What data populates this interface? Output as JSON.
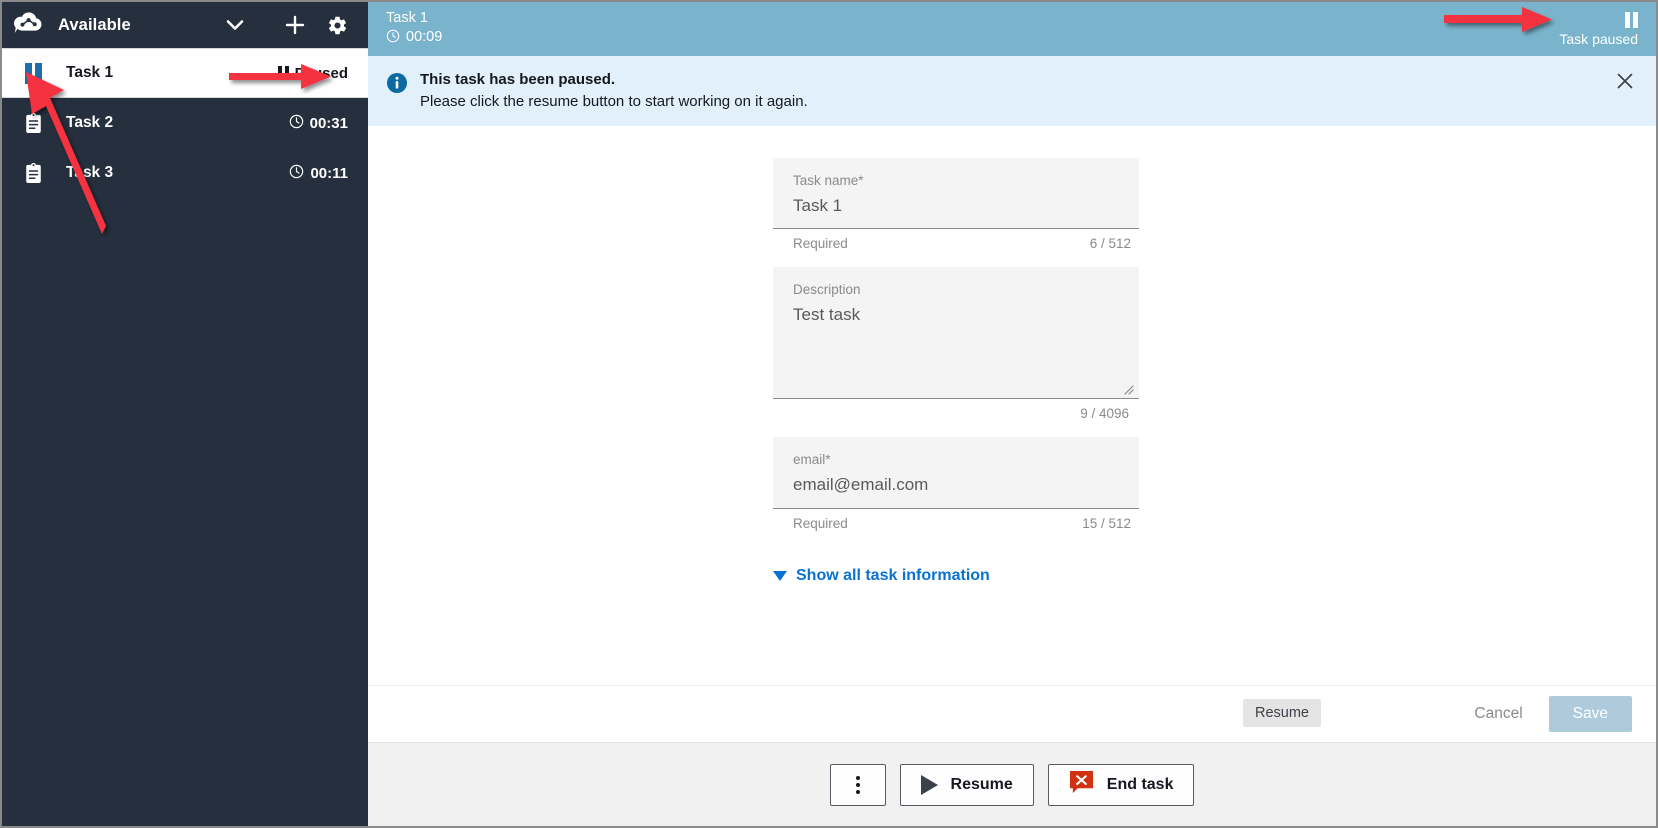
{
  "sidebar": {
    "logo_icon": "cloud-graph-logo-icon",
    "status": "Available",
    "chevron_icon": "chevron-down-icon",
    "plus_icon": "plus-icon",
    "gear_icon": "gear-icon",
    "tasks": [
      {
        "name": "Task 1",
        "icon": "pause-icon",
        "meta": "Paused",
        "meta_icon": "pause-icon",
        "active": true
      },
      {
        "name": "Task 2",
        "icon": "clipboard-icon",
        "meta": "00:31",
        "meta_icon": "clock-icon",
        "active": false
      },
      {
        "name": "Task 3",
        "icon": "clipboard-icon",
        "meta": "00:11",
        "meta_icon": "clock-icon",
        "active": false
      }
    ]
  },
  "task_header": {
    "title": "Task 1",
    "timer": "00:09",
    "timer_icon": "clock-icon",
    "status": "Task paused",
    "status_icon": "pause-icon",
    "bg_color": "#7ab4cc"
  },
  "banner": {
    "icon": "info-icon",
    "title": "This task has been paused.",
    "subtitle": "Please click the resume button to start working on it again.",
    "close_icon": "close-icon",
    "bg_color": "#e1f0fa"
  },
  "form": {
    "fields": [
      {
        "label": "Task name*",
        "value": "Task 1",
        "help_left": "Required",
        "help_right": "6 / 512",
        "type": "text"
      },
      {
        "label": "Description",
        "value": "Test task",
        "help_left": "",
        "help_right": "9 / 4096",
        "type": "textarea"
      },
      {
        "label": "email*",
        "value": "email@email.com",
        "help_left": "Required",
        "help_right": "15 / 512",
        "type": "text"
      }
    ],
    "show_all_label": "Show all task information",
    "show_all_icon": "triangle-down-icon",
    "link_color": "#0972d3"
  },
  "save_bar": {
    "cancel_label": "Cancel",
    "save_label": "Save",
    "save_color": "#aecadb"
  },
  "action_bar": {
    "tooltip": "Resume",
    "more_icon": "kebab-menu-icon",
    "resume_icon": "play-icon",
    "resume_label": "Resume",
    "end_icon": "end-task-icon",
    "end_label": "End task",
    "end_icon_color": "#d13212"
  },
  "annotations": {
    "arrow_color": "#f5333f"
  }
}
